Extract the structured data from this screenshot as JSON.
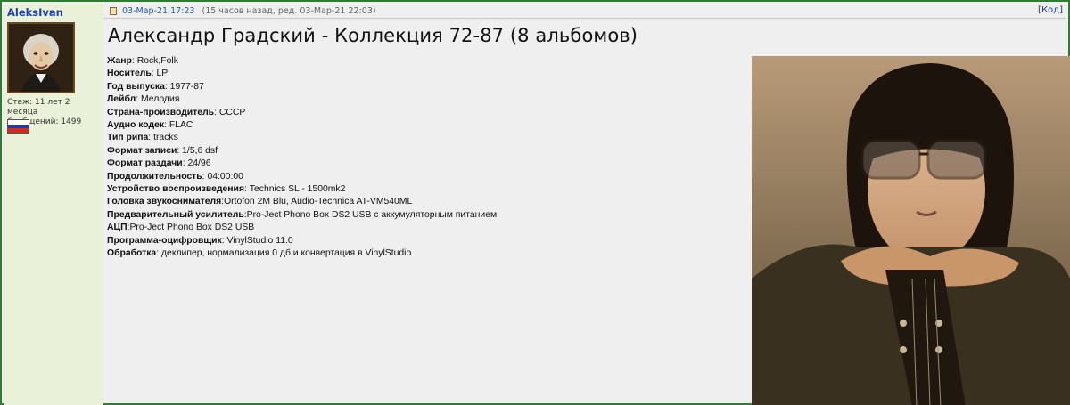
{
  "user": {
    "name": "AleksIvan",
    "tenure": "Стаж: 11 лет 2 месяца",
    "posts": "Сообщений: 1499",
    "flag_colors": [
      "#ffffff",
      "#1b3ea8",
      "#d52b1e"
    ]
  },
  "post": {
    "date": "03-Мар-21 17:23",
    "edit_info": "(15 часов назад, ред. 03-Мар-21 22:03)",
    "code_link": "Код",
    "title": "Александр Градский - Коллекция 72-87 (8 альбомов)",
    "details": [
      {
        "label": "Жанр",
        "sep": ": ",
        "value": "Rock,Folk"
      },
      {
        "label": "Носитель",
        "sep": ": ",
        "value": "LP"
      },
      {
        "label": "Год выпуска",
        "sep": ": ",
        "value": "1977-87"
      },
      {
        "label": "Лейбл",
        "sep": ": ",
        "value": "Мелодия"
      },
      {
        "label": "Страна-производитель",
        "sep": ": ",
        "value": "СССР"
      },
      {
        "label": "Аудио кодек",
        "sep": ": ",
        "value": "FLAC"
      },
      {
        "label": "Тип рипа",
        "sep": ": ",
        "value": "tracks"
      },
      {
        "label": "Формат записи",
        "sep": ": ",
        "value": "1/5,6 dsf"
      },
      {
        "label": "Формат раздачи",
        "sep": ": ",
        "value": "24/96"
      },
      {
        "label": "Продолжительность",
        "sep": ": ",
        "value": "04:00:00"
      },
      {
        "label": "Устройство воспроизведения",
        "sep": ": ",
        "value": "Technics SL - 1500mk2"
      },
      {
        "label": "Головка звукоснимателя",
        "sep": ":",
        "value": "Ortofon 2M Blu, Audio-Technica AT-VM540ML"
      },
      {
        "label": "Предварительный усилитель",
        "sep": ":",
        "value": "Pro-Ject Phono Box DS2 USB с аккумуляторным питанием"
      },
      {
        "label": "АЦП",
        "sep": ":",
        "value": "Pro-Ject Phono Box DS2 USB"
      },
      {
        "label": "Программа-оцифровщик",
        "sep": ": ",
        "value": "VinylStudio 11.0"
      },
      {
        "label": "Обработка",
        "sep": ": ",
        "value": "деклипер, нормализация 0 дб и конвертация в VinylStudio"
      }
    ]
  },
  "colors": {
    "frame_border": "#2e7d32",
    "username": "#1a3fb3",
    "date_link": "#1a5fb3",
    "sidebar_bg": "#e9f1d8",
    "post_bg": "#efefef"
  }
}
